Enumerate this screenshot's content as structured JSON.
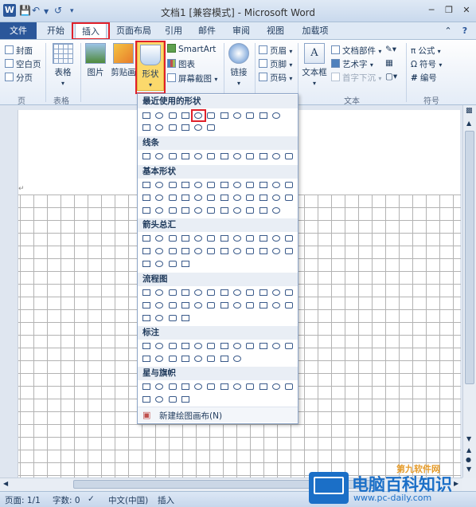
{
  "window": {
    "title": "文档1 [兼容模式] - Microsoft Word",
    "qat": [
      "save-icon",
      "undo-icon",
      "redo-icon",
      "customize-icon"
    ],
    "controls": [
      "minimize-icon",
      "restore-icon",
      "close-icon"
    ]
  },
  "tabs": {
    "file": "文件",
    "items": [
      "开始",
      "插入",
      "页面布局",
      "引用",
      "邮件",
      "审阅",
      "视图",
      "加载项"
    ],
    "active": "插入"
  },
  "ribbon": {
    "pages": {
      "cover": "封面",
      "blank": "空白页",
      "break": "分页",
      "label": "页"
    },
    "table": {
      "btn": "表格",
      "label": "表格"
    },
    "illustrations": {
      "picture": "图片",
      "clipart": "剪贴画",
      "shapes": "形状",
      "smartart": "SmartArt",
      "chart": "图表",
      "screenshot": "屏幕截图"
    },
    "links": {
      "btn": "链接"
    },
    "header_footer": {
      "header": "页眉",
      "footer": "页脚",
      "page_number": "页码"
    },
    "text": {
      "textbox": "文本框",
      "quickparts": "文档部件",
      "wordart": "艺术字",
      "dropcap": "首字下沉",
      "label": "文本"
    },
    "symbols": {
      "equation": "公式",
      "symbol": "符号",
      "number": "编号",
      "label": "符号"
    }
  },
  "gallery": {
    "sections": [
      {
        "title": "最近使用的形状",
        "rows": [
          11,
          6
        ]
      },
      {
        "title": "线条",
        "rows": [
          12
        ]
      },
      {
        "title": "基本形状",
        "rows": [
          12,
          12,
          11
        ]
      },
      {
        "title": "箭头总汇",
        "rows": [
          12,
          12,
          4
        ]
      },
      {
        "title": "流程图",
        "rows": [
          12,
          12,
          4
        ]
      },
      {
        "title": "标注",
        "rows": [
          12,
          8
        ]
      },
      {
        "title": "星与旗帜",
        "rows": [
          12,
          4
        ]
      }
    ],
    "new_canvas": "新建绘图画布(N)"
  },
  "status": {
    "page": "页面: 1/1",
    "words": "字数: 0",
    "language": "中文(中国)",
    "mode": "插入"
  },
  "watermark": {
    "text1": "电脑百科知识",
    "text2": "www.pc-daily.com",
    "text3": "第九软件网"
  }
}
